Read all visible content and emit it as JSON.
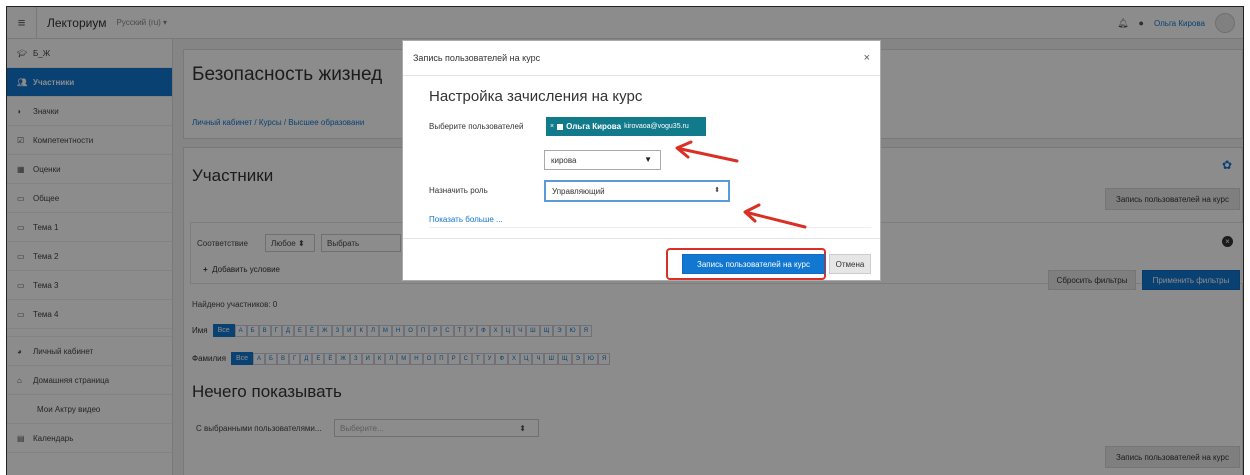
{
  "navbar": {
    "brand": "Лекториум",
    "language": "Русский (ru) ▾",
    "user_name": "Ольга Кирова",
    "bell_icon": "bell-icon",
    "chat_icon": "chat-icon"
  },
  "sidebar": {
    "items": [
      {
        "label": "Б_Ж",
        "icon": "graduation-cap-icon"
      },
      {
        "label": "Участники",
        "icon": "users-icon",
        "active": true
      },
      {
        "label": "Значки",
        "icon": "badge-icon"
      },
      {
        "label": "Компетентности",
        "icon": "checkbox-icon"
      },
      {
        "label": "Оценки",
        "icon": "table-icon"
      },
      {
        "label": "Общее",
        "icon": "folder-icon"
      },
      {
        "label": "Тема 1",
        "icon": "folder-icon"
      },
      {
        "label": "Тема 2",
        "icon": "folder-icon"
      },
      {
        "label": "Тема 3",
        "icon": "folder-icon"
      },
      {
        "label": "Тема 4",
        "icon": "folder-icon"
      },
      {
        "label": "Личный кабинет",
        "icon": "dashboard-icon"
      },
      {
        "label": "Домашняя страница",
        "icon": "home-icon"
      },
      {
        "label": "Мои Актру видео",
        "icon": ""
      },
      {
        "label": "Календарь",
        "icon": "calendar-icon"
      }
    ]
  },
  "main": {
    "page_title": "Безопасность жизнед",
    "breadcrumb": "Личный кабинет / Курсы / Высшее образовани",
    "participants_title": "Участники",
    "enrol_users_button": "Запись пользователей на курс",
    "filter": {
      "match_label": "Соответствие",
      "match_value": "Любое ⬍",
      "choose_value": "Выбрать",
      "add_condition": "Добавить условие",
      "reset_button": "Сбросить фильтры",
      "apply_button": "Применить фильтры"
    },
    "found_count": "Найдено участников: 0",
    "first_name_label": "Имя",
    "last_name_label": "Фамилия",
    "all_label": "Все",
    "letters": [
      "А",
      "Б",
      "В",
      "Г",
      "Д",
      "Е",
      "Ё",
      "Ж",
      "З",
      "И",
      "К",
      "Л",
      "М",
      "Н",
      "О",
      "П",
      "Р",
      "С",
      "Т",
      "У",
      "Ф",
      "Х",
      "Ц",
      "Ч",
      "Ш",
      "Щ",
      "Э",
      "Ю",
      "Я"
    ],
    "nothing_to_show": "Нечего показывать",
    "with_selected_label": "С выбранными пользователями...",
    "with_selected_placeholder": "Выберите...",
    "enrol_users_button_bottom": "Запись пользователей на курс"
  },
  "modal": {
    "title": "Запись пользователей на курс",
    "heading": "Настройка зачисления на курс",
    "select_users_label": "Выберите пользователей",
    "chip_name": "Ольга Кирова",
    "chip_email": "kirovaoa@vogu35.ru",
    "search_value": "кирова",
    "assign_role_label": "Назначить роль",
    "role_value": "Управляющий",
    "show_more": "Показать больше ...",
    "enrol_button": "Запись пользователей на курс",
    "cancel_button": "Отмена"
  },
  "colors": {
    "primary": "#1177d1",
    "chip": "#117a8b",
    "annotation": "#d93025"
  }
}
